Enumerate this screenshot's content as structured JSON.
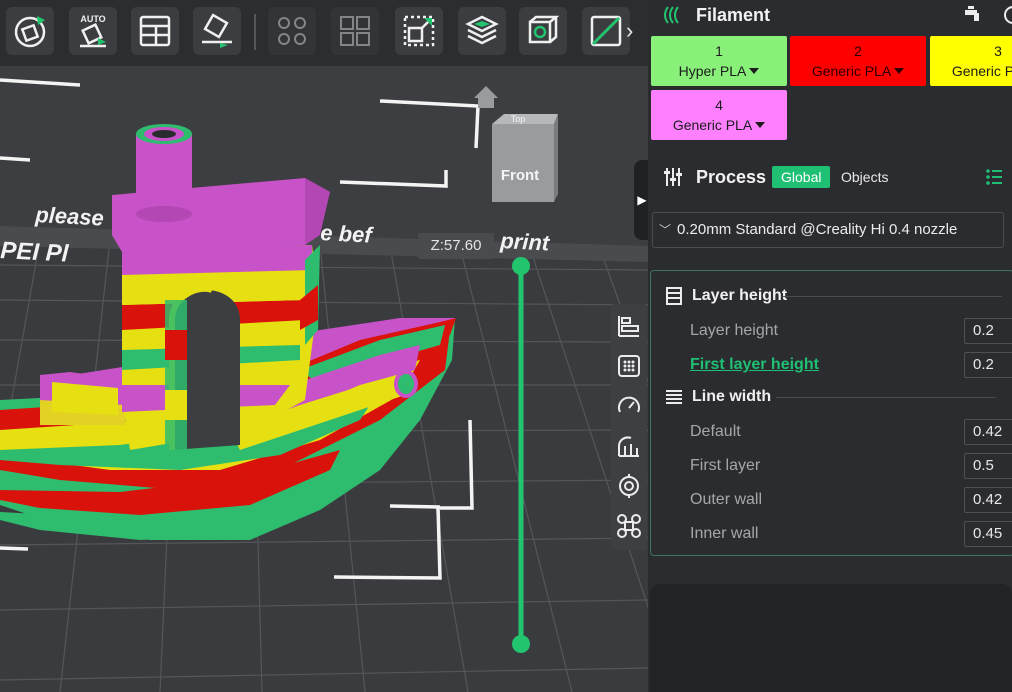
{
  "toolbar": {
    "auto_badge": "AUTO",
    "buttons": [
      {
        "name": "orient-button",
        "icon": "orient-icon"
      },
      {
        "name": "auto-orient-button",
        "icon": "auto-orient-icon"
      },
      {
        "name": "arrange-button",
        "icon": "arrange-icon"
      },
      {
        "name": "lay-on-face-button",
        "icon": "lay-on-face-icon"
      },
      {
        "name": "split-objects-button",
        "icon": "split-objects-icon"
      },
      {
        "name": "split-parts-button",
        "icon": "split-parts-icon"
      },
      {
        "name": "scale-button",
        "icon": "scale-icon"
      },
      {
        "name": "layers-button",
        "icon": "layers-icon"
      },
      {
        "name": "cube-view-button",
        "icon": "cube-icon"
      },
      {
        "name": "cut-button",
        "icon": "cut-icon"
      }
    ],
    "more": "›"
  },
  "viewport": {
    "view_cube_front": "Front",
    "view_cube_top": "Top",
    "z_label": "Z:57.60",
    "bed_text_line1": "please",
    "bed_text_line2": "PEI",
    "bed_text_line3": "e bef",
    "bed_text_line4": "print",
    "collapse_glyph": "▶",
    "colors": {
      "green": "#2ebd6e",
      "red": "#d9120c",
      "yellow": "#e6df12",
      "magenta": "#d050d0",
      "slider": "#22c46e"
    }
  },
  "filament": {
    "title": "Filament",
    "cards": [
      {
        "num": "1",
        "name": "Hyper PLA",
        "bg": "#89f07a",
        "fg": "#1c1c1c"
      },
      {
        "num": "2",
        "name": "Generic PLA",
        "bg": "#ff0000",
        "fg": "#2a0000"
      },
      {
        "num": "3",
        "name": "Generic PLA",
        "bg": "#ffff00",
        "fg": "#1c1c1c"
      },
      {
        "num": "4",
        "name": "Generic PLA",
        "bg": "#ff80ff",
        "fg": "#1c1c1c"
      }
    ]
  },
  "process": {
    "title": "Process",
    "global_label": "Global",
    "objects_label": "Objects",
    "preset": "0.20mm Standard @Creality Hi 0.4 nozzle",
    "accent": "#1fbf74",
    "groups": {
      "layer_height_title": "Layer height",
      "line_width_title": "Line width"
    },
    "rows": {
      "layer_height": {
        "label": "Layer height",
        "value": "0.2"
      },
      "first_layer_height": {
        "label": "First layer height",
        "value": "0.2"
      },
      "default": {
        "label": "Default",
        "value": "0.42"
      },
      "first_layer": {
        "label": "First layer",
        "value": "0.5"
      },
      "outer_wall": {
        "label": "Outer wall",
        "value": "0.42"
      },
      "inner_wall": {
        "label": "Inner wall",
        "value": "0.45"
      }
    }
  }
}
